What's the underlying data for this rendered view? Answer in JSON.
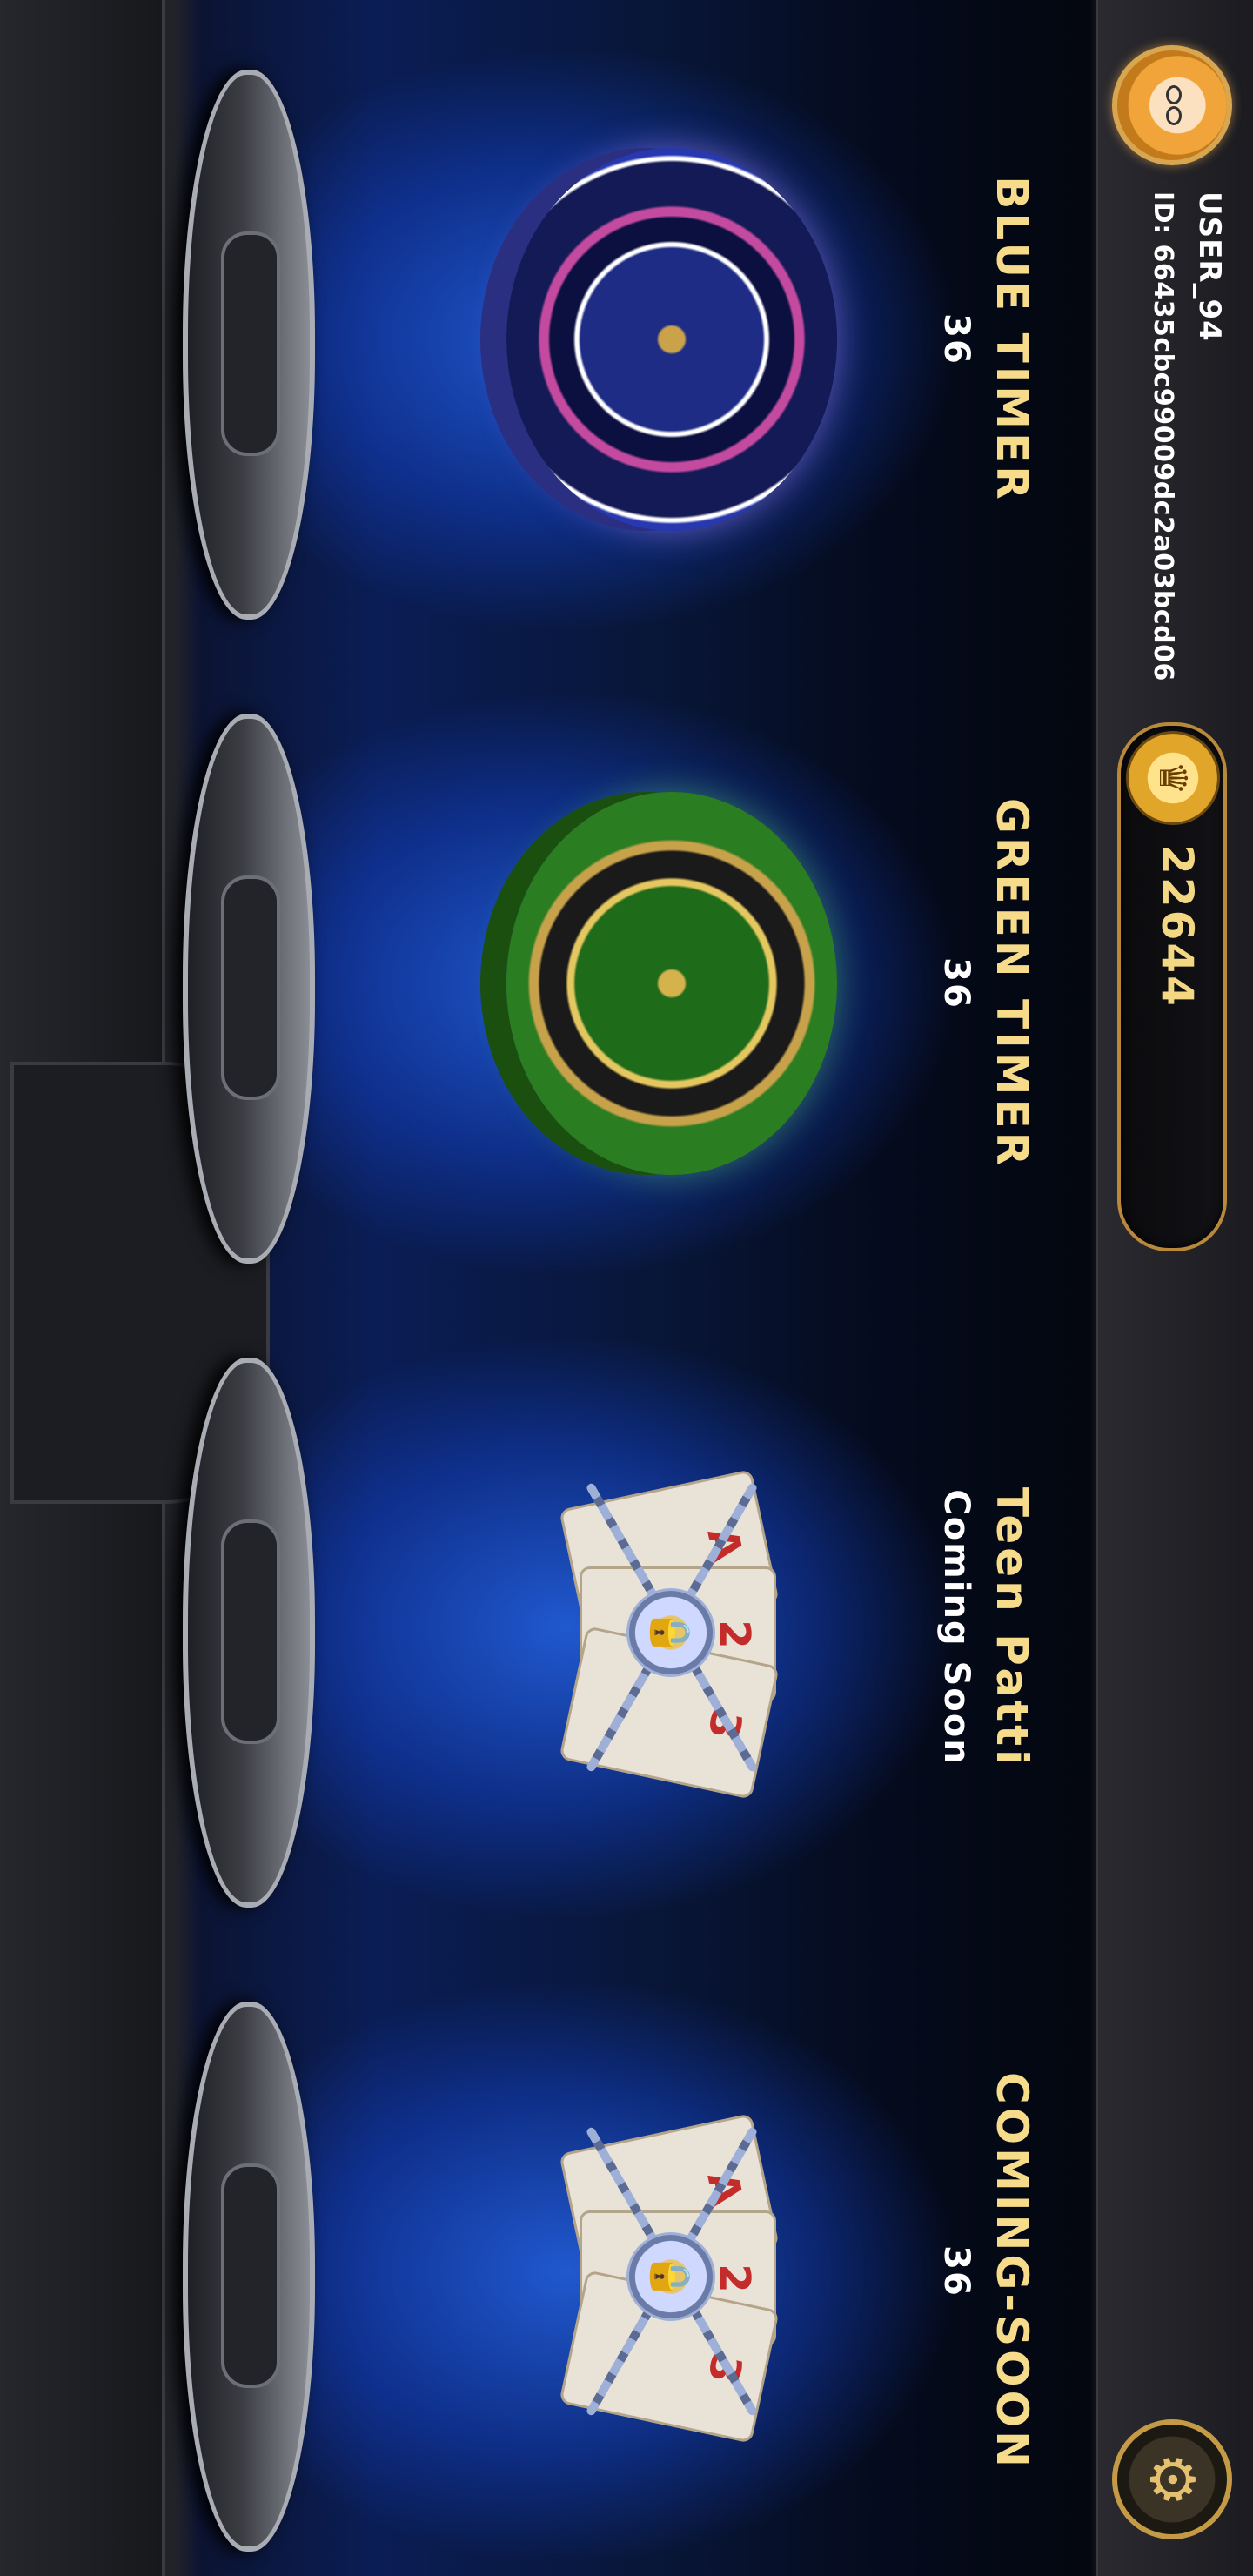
{
  "header": {
    "username": "USER_94",
    "user_id": "ID: 66435cbc99009dc2a03bcd06",
    "coins": "22644"
  },
  "games": [
    {
      "title": "BLUE TIMER",
      "subtitle": "36",
      "art": "blue-roulette-wheel",
      "locked": false
    },
    {
      "title": "GREEN TIMER",
      "subtitle": "36",
      "art": "green-roulette-wheel",
      "locked": false
    },
    {
      "title": "Teen Patti",
      "subtitle": "Coming Soon",
      "art": "locked-playing-cards",
      "locked": true
    },
    {
      "title": "COMING-SOON",
      "subtitle": "36",
      "art": "locked-playing-cards",
      "locked": true
    }
  ],
  "cards_art": {
    "rank_a": "A",
    "rank_2": "2",
    "rank_3": "3"
  },
  "icons": {
    "settings": "gear-icon",
    "coin": "coin-icon",
    "lock": "padlock-icon"
  },
  "colors": {
    "accent_gold": "#f6db8a",
    "glow_blue": "#2a6bff"
  }
}
